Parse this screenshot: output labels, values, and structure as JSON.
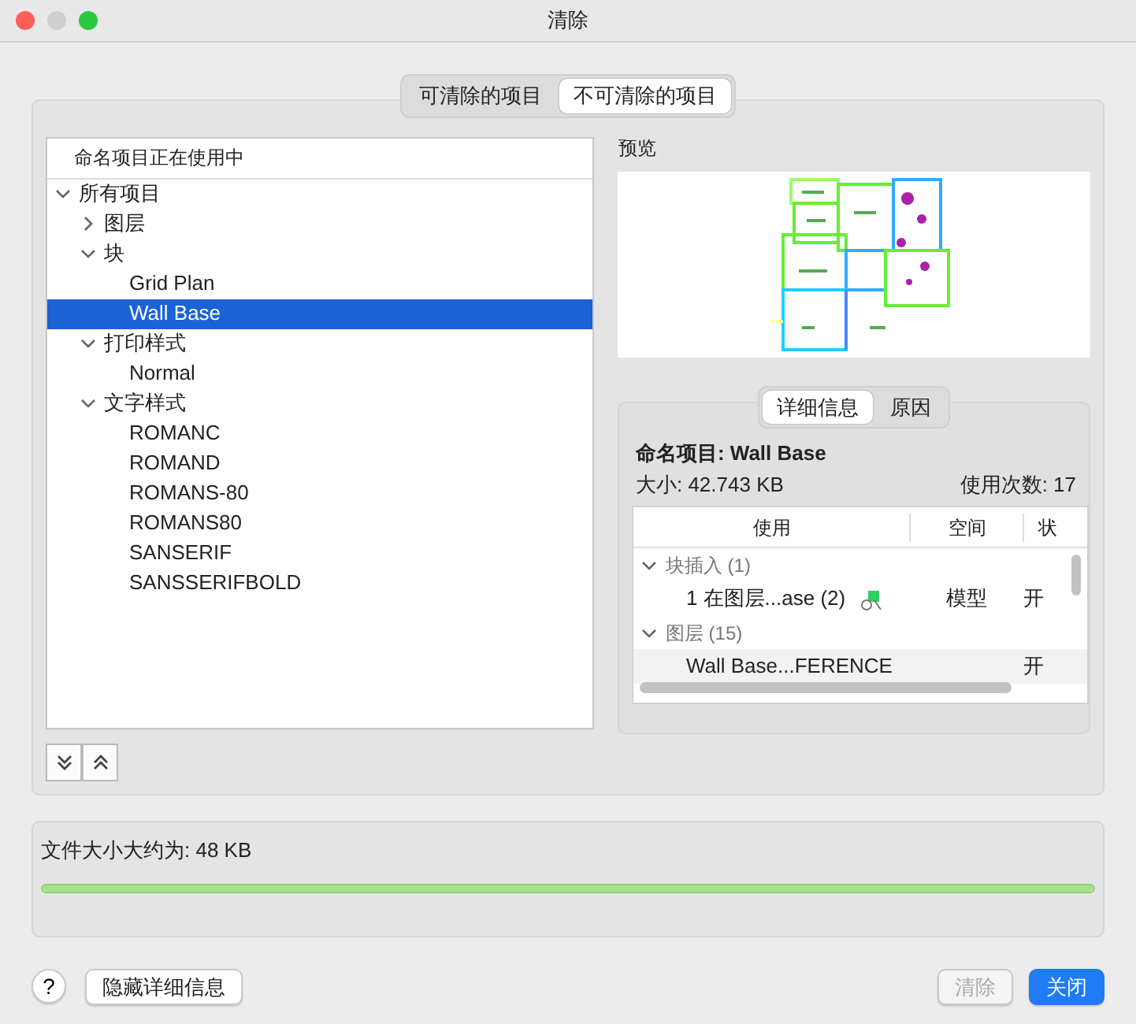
{
  "window": {
    "title": "清除"
  },
  "tabs": [
    {
      "label": "可清除的项目",
      "selected": false
    },
    {
      "label": "不可清除的项目",
      "selected": true
    }
  ],
  "tree": {
    "header": "命名项目正在使用中",
    "items": [
      {
        "label": "所有项目",
        "expanded": true,
        "selected": false,
        "children": [
          {
            "label": "图层",
            "expanded": false,
            "selected": false
          },
          {
            "label": "块",
            "expanded": true,
            "selected": false,
            "children": [
              {
                "label": "Grid Plan",
                "selected": false
              },
              {
                "label": "Wall Base",
                "selected": true
              }
            ]
          },
          {
            "label": "打印样式",
            "expanded": true,
            "selected": false,
            "children": [
              {
                "label": "Normal",
                "selected": false
              }
            ]
          },
          {
            "label": "文字样式",
            "expanded": true,
            "selected": false,
            "children": [
              {
                "label": "ROMANC",
                "selected": false
              },
              {
                "label": "ROMAND",
                "selected": false
              },
              {
                "label": "ROMANS-80",
                "selected": false
              },
              {
                "label": "ROMANS80",
                "selected": false
              },
              {
                "label": "SANSERIF",
                "selected": false
              },
              {
                "label": "SANSSERIFBOLD",
                "selected": false
              }
            ]
          }
        ]
      }
    ]
  },
  "preview": {
    "label": "预览"
  },
  "detail_tabs": [
    {
      "label": "详细信息",
      "selected": true
    },
    {
      "label": "原因",
      "selected": false
    }
  ],
  "details": {
    "name_label": "命名项目:",
    "name": "Wall Base",
    "size": "大小: 42.743 KB",
    "uses": "使用次数: 17",
    "columns": [
      "使用",
      "空间",
      "状"
    ],
    "groups": [
      {
        "label": "块插入 (1)",
        "expanded": true,
        "rows": [
          {
            "kind": "block",
            "cells": [
              "1 在图层...ase (2)",
              "模型",
              "开"
            ]
          }
        ]
      },
      {
        "label": "图层 (15)",
        "expanded": true,
        "rows": [
          {
            "kind": "layer",
            "cells": [
              "Wall Base...FERENCE",
              "",
              "开"
            ]
          }
        ]
      }
    ]
  },
  "file_size": {
    "label": "文件大小大约为: 48 KB",
    "level": 1
  },
  "buttons": [
    {
      "label": "隐藏详细信息",
      "kind": "secondary",
      "disabled": false
    },
    {
      "label": "清除",
      "kind": "secondary",
      "disabled": true
    },
    {
      "label": "关闭",
      "kind": "primary",
      "disabled": false
    }
  ],
  "help": {
    "label": "?"
  }
}
